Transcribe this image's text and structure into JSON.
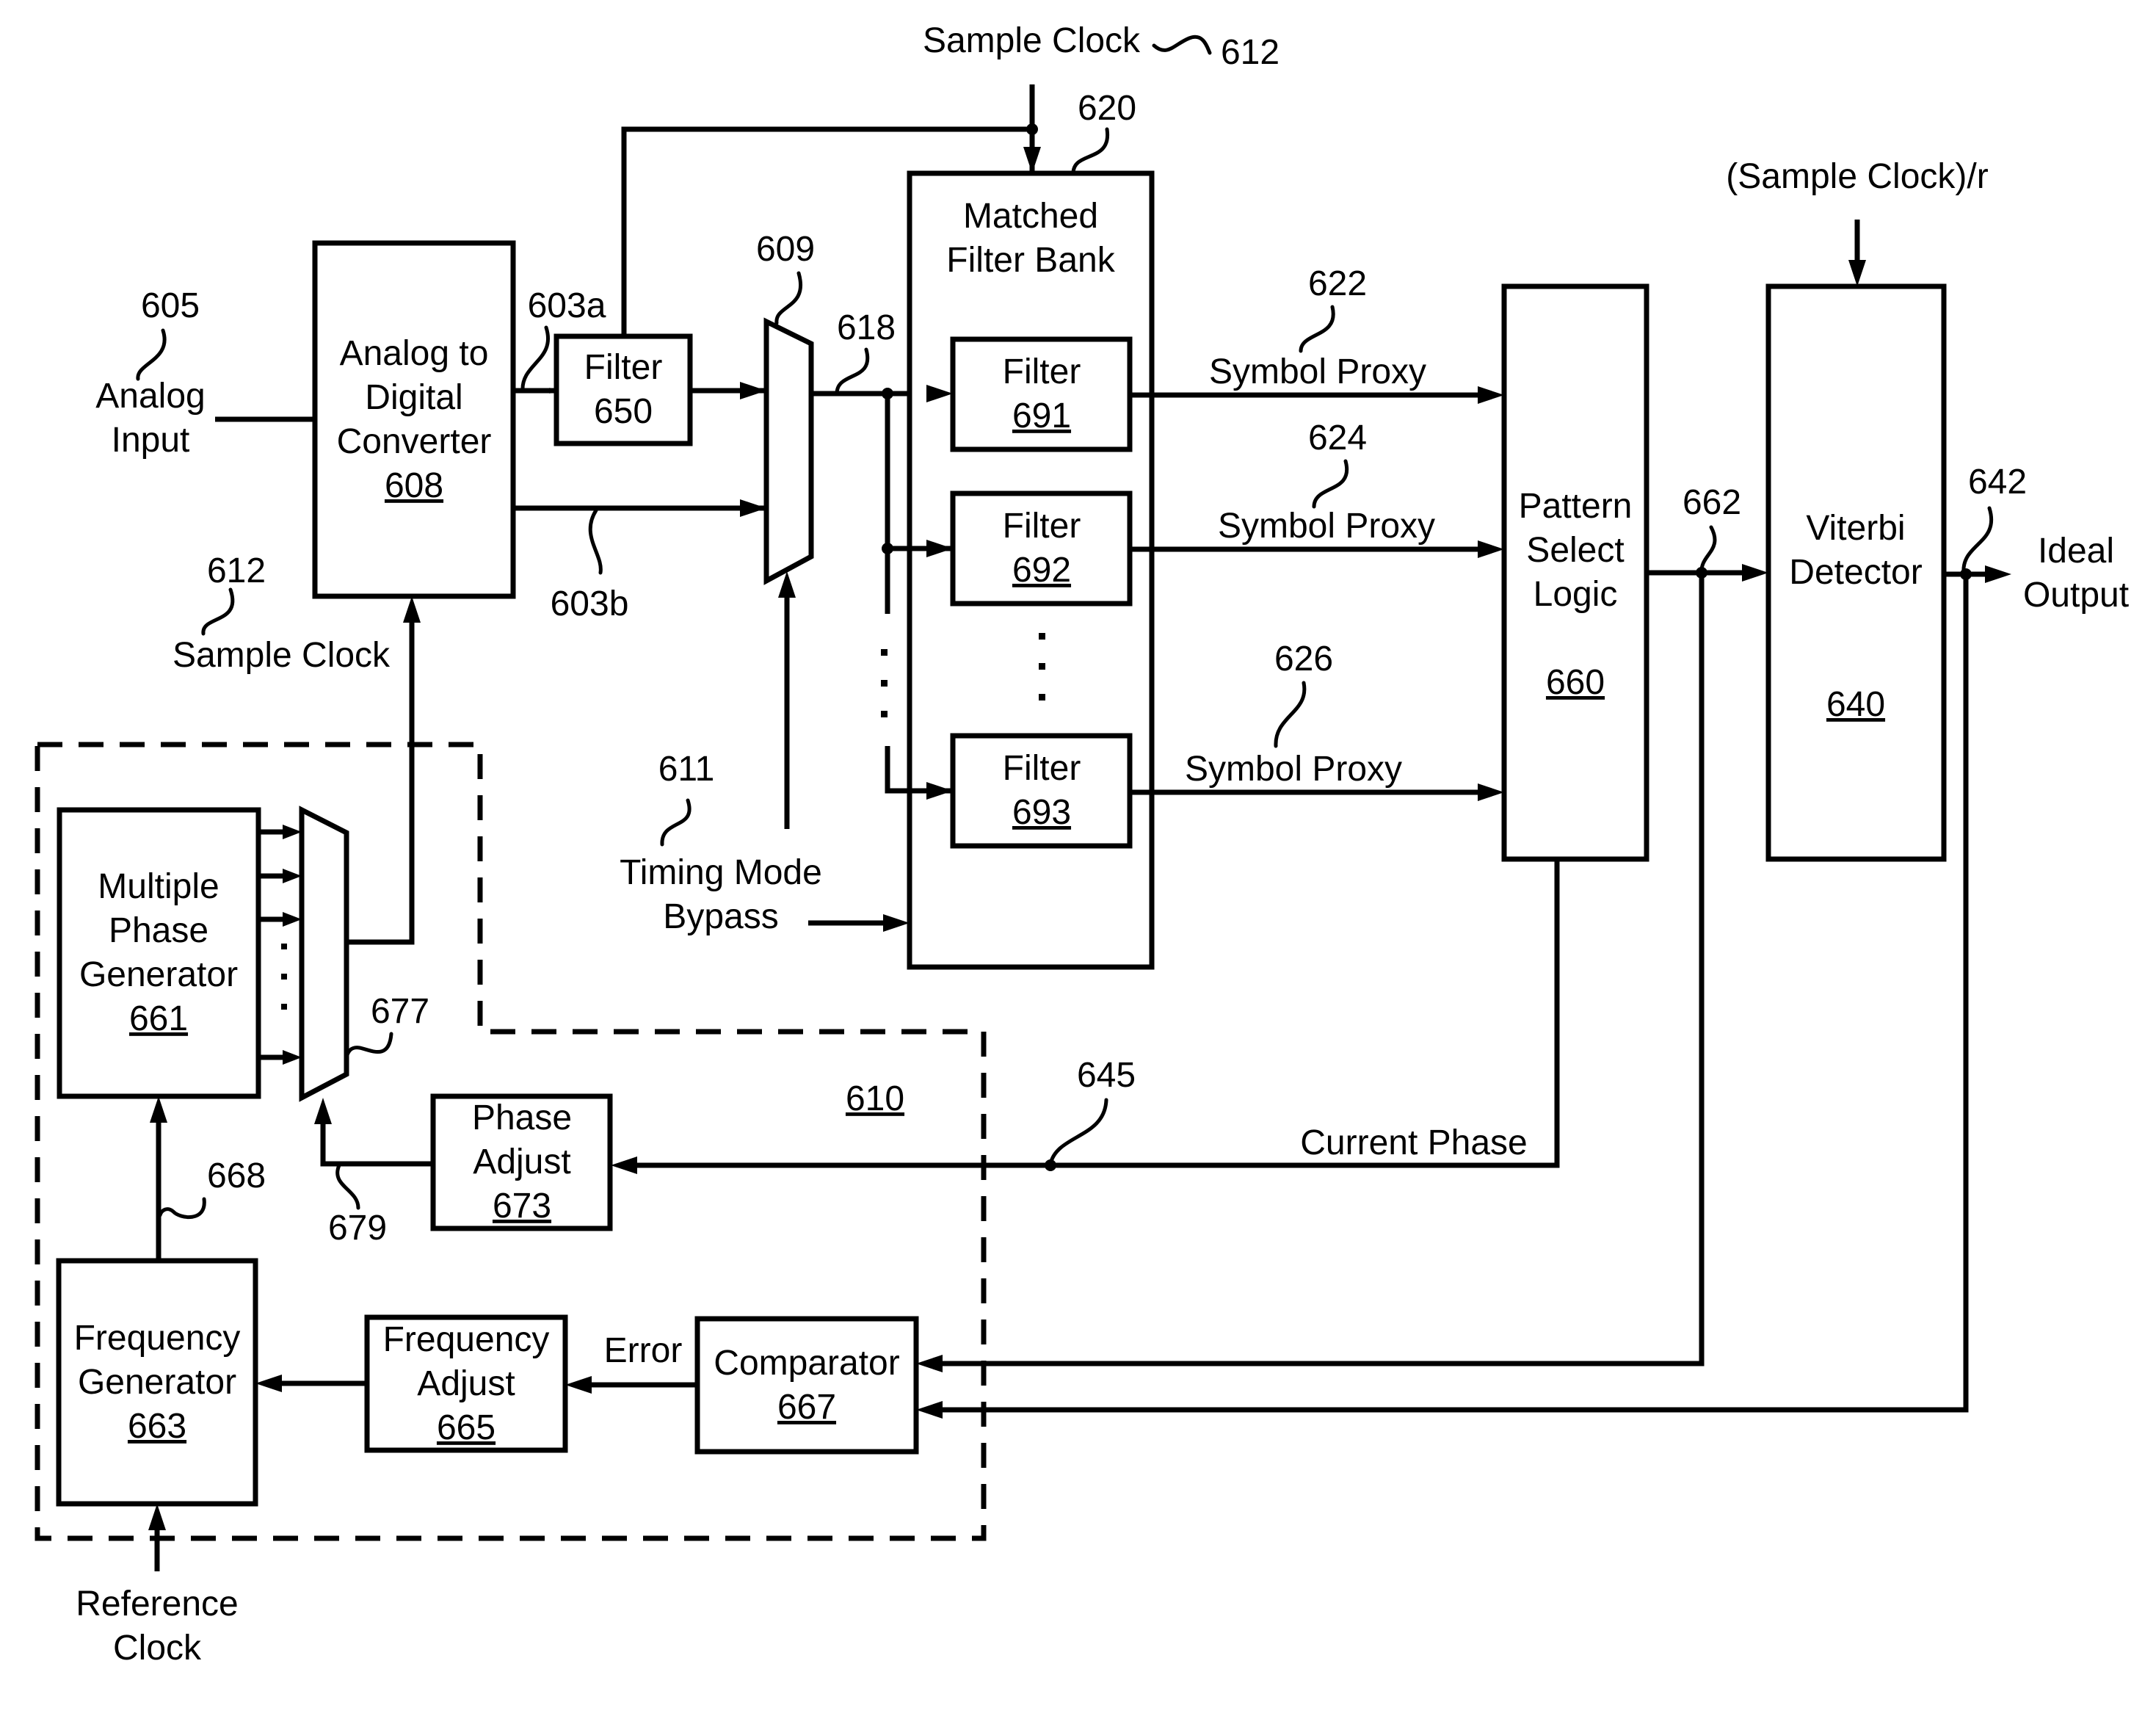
{
  "figure": {
    "title": "Timing recovery and matched filter bank block diagram",
    "colors": {
      "ink": "#000000",
      "background": "#ffffff"
    }
  },
  "inputs": {
    "analog_input": {
      "ref": "605",
      "lines": [
        "Analog",
        "Input"
      ]
    },
    "sample_clock_top": {
      "label": "Sample Clock",
      "ref": "612"
    },
    "sample_clock_left": {
      "label": "Sample Clock",
      "ref": "612"
    },
    "sample_clock_div": {
      "label": "(Sample Clock)/r"
    },
    "timing_mode_bypass": {
      "ref": "611",
      "lines": [
        "Timing Mode",
        "Bypass"
      ]
    },
    "reference_clock": {
      "lines": [
        "Reference",
        "Clock"
      ]
    }
  },
  "blocks": {
    "adc": {
      "lines": [
        "Analog to",
        "Digital",
        "Converter"
      ],
      "ref": "608"
    },
    "filter650": {
      "lines": [
        "Filter",
        "650"
      ]
    },
    "mux609": {
      "ref": "609"
    },
    "matched_filter_bank": {
      "lines": [
        "Matched",
        "Filter Bank"
      ],
      "ref": "620"
    },
    "filter691": {
      "label": "Filter",
      "ref": "691"
    },
    "filter692": {
      "label": "Filter",
      "ref": "692"
    },
    "filter693": {
      "label": "Filter",
      "ref": "693"
    },
    "pattern_select": {
      "lines": [
        "Pattern",
        "Select",
        "Logic"
      ],
      "ref": "660"
    },
    "viterbi": {
      "lines": [
        "Viterbi",
        "Detector"
      ],
      "ref": "640"
    },
    "multi_phase_gen": {
      "lines": [
        "Multiple",
        "Phase",
        "Generator"
      ],
      "ref": "661"
    },
    "mux677": {
      "ref": "677"
    },
    "phase_adjust": {
      "lines": [
        "Phase",
        "Adjust"
      ],
      "ref": "673"
    },
    "freq_gen": {
      "lines": [
        "Frequency",
        "Generator"
      ],
      "ref": "663"
    },
    "freq_adjust": {
      "lines": [
        "Frequency",
        "Adjust"
      ],
      "ref": "665"
    },
    "comparator": {
      "label": "Comparator",
      "ref": "667"
    },
    "timing_loop": {
      "ref": "610"
    }
  },
  "signals": {
    "s603a": "603a",
    "s603b": "603b",
    "s618": "618",
    "symbol_proxy_1": {
      "label": "Symbol Proxy",
      "ref": "622"
    },
    "symbol_proxy_2": {
      "label": "Symbol Proxy",
      "ref": "624"
    },
    "symbol_proxy_3": {
      "label": "Symbol Proxy",
      "ref": "626"
    },
    "s662": "662",
    "s642": "642",
    "ideal_output": {
      "lines": [
        "Ideal",
        "Output"
      ]
    },
    "current_phase": {
      "label": "Current Phase",
      "ref": "645"
    },
    "s668": "668",
    "s679": "679",
    "error": "Error"
  }
}
